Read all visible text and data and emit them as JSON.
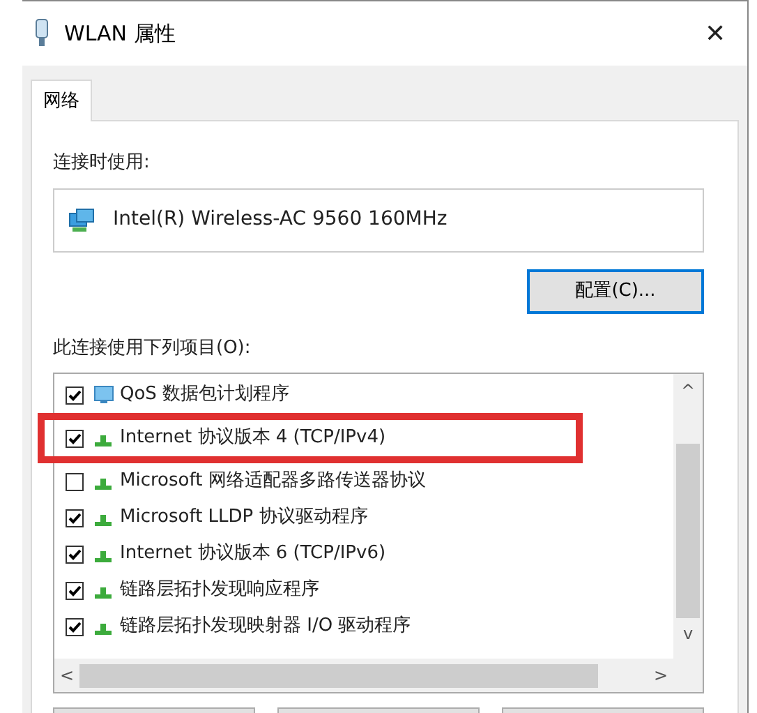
{
  "window": {
    "title": "WLAN 属性",
    "close": "✕"
  },
  "tabs": [
    {
      "label": "网络",
      "selected": true
    }
  ],
  "connect_using": {
    "label": "连接时使用:",
    "adapter": "Intel(R) Wireless-AC 9560 160MHz"
  },
  "configure_button": {
    "label": "配置(C)...",
    "focused": true
  },
  "items_label": "此连接使用下列项目(O):",
  "items": [
    {
      "label": "QoS 数据包计划程序",
      "checked": true,
      "kind": "service"
    },
    {
      "label": "Internet 协议版本 4 (TCP/IPv4)",
      "checked": true,
      "kind": "protocol",
      "highlighted": true
    },
    {
      "label": "Microsoft 网络适配器多路传送器协议",
      "checked": false,
      "kind": "protocol",
      "highlighted": false
    },
    {
      "label": "Microsoft LLDP 协议驱动程序",
      "checked": true,
      "kind": "protocol",
      "highlighted": false
    },
    {
      "label": "Internet 协议版本 6 (TCP/IPv6)",
      "checked": true,
      "kind": "protocol",
      "highlighted": false
    },
    {
      "label": "链路层拓扑发现响应程序",
      "checked": true,
      "kind": "protocol",
      "highlighted": false
    },
    {
      "label": "链路层拓扑发现映射器 I/O 驱动程序",
      "checked": true,
      "kind": "protocol",
      "highlighted": false
    }
  ],
  "scroll_arrows": {
    "up": "^",
    "down": "v",
    "left": "<",
    "right": ">"
  }
}
